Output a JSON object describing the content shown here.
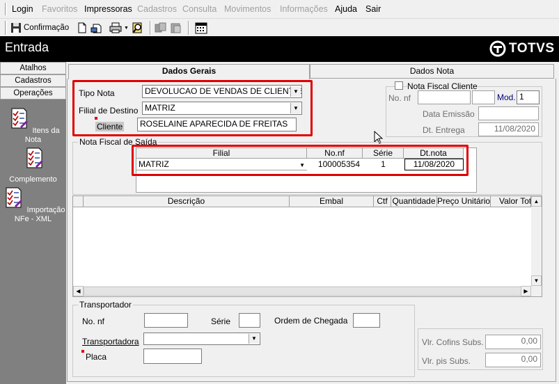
{
  "menu": {
    "items": [
      "Login",
      "Favoritos",
      "Impressoras",
      "Cadastros",
      "Consulta",
      "Movimentos",
      "Informações",
      "Ajuda",
      "Sair"
    ]
  },
  "toolbar": {
    "confirm_label": "Confirmação"
  },
  "header": {
    "title": "Entrada",
    "logo_text": "TOTVS"
  },
  "sidebar": {
    "tabs": [
      "Atalhos",
      "Cadastros",
      "Operações"
    ],
    "items": [
      "Itens da Nota",
      "Complemento",
      "Importação NFe - XML"
    ]
  },
  "tabs": {
    "general": "Dados Gerais",
    "note": "Dados Nota"
  },
  "general": {
    "tipo_nota_label": "Tipo Nota",
    "tipo_nota_value": "DEVOLUCAO DE VENDAS DE CLIENTES",
    "filial_label": "Filial de Destino",
    "filial_value": "MATRIZ",
    "cliente_label": "Cliente",
    "cliente_value": "ROSELAINE APARECIDA DE FREITAS"
  },
  "client_note": {
    "checkbox_label": "Nota Fiscal Cliente",
    "nonf_label": "No. nf",
    "nonf_value": "",
    "mod_label": "Mod.",
    "mod_value": "1",
    "data_emissao_label": "Data Emissão",
    "data_emissao_value": "",
    "dt_entrega_label": "Dt. Entrega",
    "dt_entrega_value": "11/08/2020"
  },
  "saida": {
    "group_title": "Nota Fiscal de Saída",
    "columns": [
      "Filial",
      "No.nf",
      "Série",
      "Dt.nota"
    ],
    "row": {
      "filial": "MATRIZ",
      "nonf": "100005354",
      "serie": "1",
      "dtnota": "11/08/2020"
    }
  },
  "items_grid": {
    "columns": [
      "Descrição",
      "Embal",
      "Ctf",
      "Quantidade",
      "Preço Unitário",
      "Valor Tota"
    ]
  },
  "transport": {
    "group_title": "Transportador",
    "nonf_label": "No. nf",
    "serie_label": "Série",
    "ordem_label": "Ordem de Chegada",
    "transportadora_label": "Transportadora",
    "placa_label": "Placa"
  },
  "taxes": {
    "cofins_label": "Vlr. Cofins Subs.",
    "cofins_value": "0,00",
    "pis_label": "Vlr. pis Subs.",
    "pis_value": "0,00"
  },
  "colors": {
    "highlight": "#e00000",
    "sidebar": "#808080",
    "header": "#000000",
    "mod_label": "#000080"
  }
}
